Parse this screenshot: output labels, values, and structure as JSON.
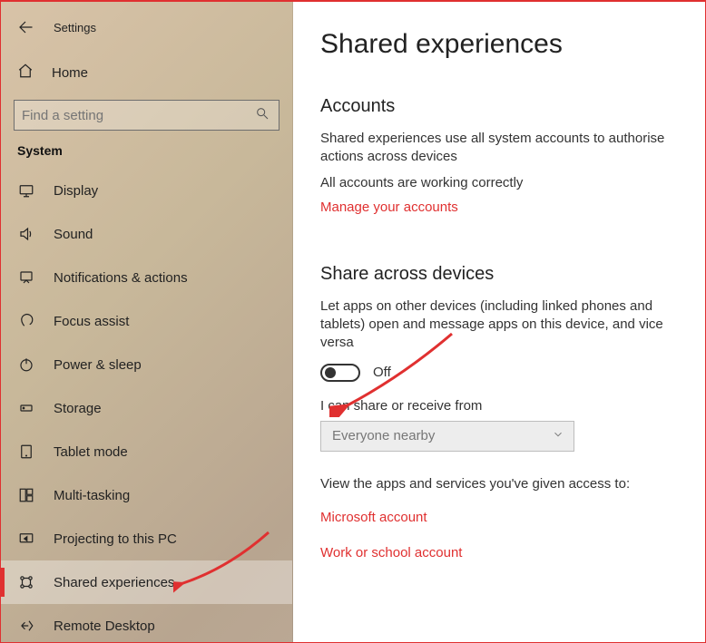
{
  "app_title": "Settings",
  "home_label": "Home",
  "search": {
    "placeholder": "Find a setting"
  },
  "section_label": "System",
  "sidebar": {
    "items": [
      {
        "name": "display",
        "label": "Display"
      },
      {
        "name": "sound",
        "label": "Sound"
      },
      {
        "name": "notifications",
        "label": "Notifications & actions"
      },
      {
        "name": "focus-assist",
        "label": "Focus assist"
      },
      {
        "name": "power-sleep",
        "label": "Power & sleep"
      },
      {
        "name": "storage",
        "label": "Storage"
      },
      {
        "name": "tablet-mode",
        "label": "Tablet mode"
      },
      {
        "name": "multi-tasking",
        "label": "Multi-tasking"
      },
      {
        "name": "projecting",
        "label": "Projecting to this PC"
      },
      {
        "name": "shared-exp",
        "label": "Shared experiences",
        "selected": true
      },
      {
        "name": "remote-desktop",
        "label": "Remote Desktop"
      }
    ]
  },
  "main": {
    "title": "Shared experiences",
    "accounts": {
      "heading": "Accounts",
      "desc": "Shared experiences use all system accounts to authorise actions across devices",
      "status": "All accounts are working correctly",
      "manage_link": "Manage your accounts"
    },
    "share": {
      "heading": "Share across devices",
      "desc": "Let apps on other devices (including linked phones and tablets) open and message apps on this device, and vice versa",
      "toggle_state": "Off",
      "toggle_on": false,
      "receive_label": "I can share or receive from",
      "dropdown_value": "Everyone nearby"
    },
    "access": {
      "label": "View the apps and services you've given access to:",
      "microsoft_link": "Microsoft account",
      "work_link": "Work or school account"
    }
  }
}
